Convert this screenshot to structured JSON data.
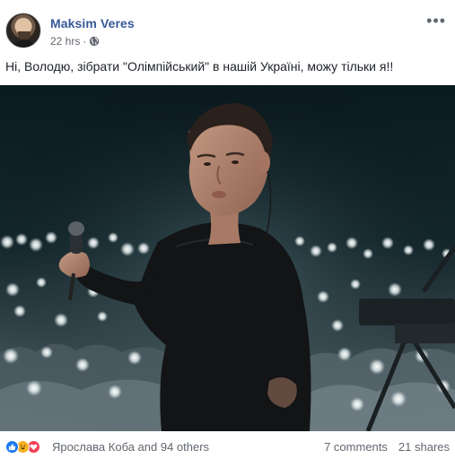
{
  "post": {
    "author": "Maksim Veres",
    "time": "22 hrs",
    "separator": "·",
    "privacy_icon": "globe-icon",
    "more_label": "•••",
    "text": "Ні, Володю, зібрати \"Олімпійський\" в нашій Україні, можу тільки я!!"
  },
  "footer": {
    "reaction_icons": [
      "like-icon",
      "haha-icon",
      "love-icon"
    ],
    "reactors": "Ярослава Коба and 94 others",
    "comments": "7 comments",
    "shares": "21 shares"
  },
  "colors": {
    "author_link": "#365899",
    "meta_text": "#616770",
    "like": "#1877f2",
    "haha": "#f7b125",
    "love": "#f33e58"
  }
}
